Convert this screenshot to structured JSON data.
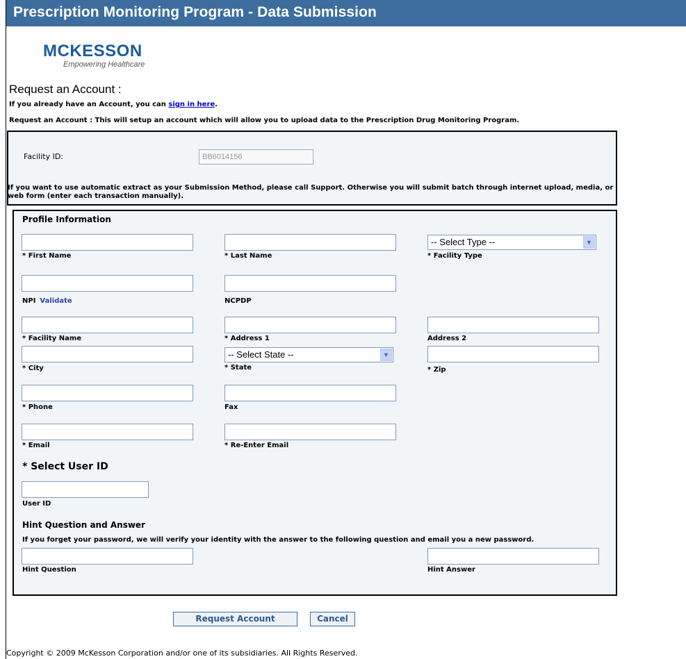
{
  "header": {
    "title": "Prescription Monitoring Program - Data Submission"
  },
  "logo": {
    "brand": "MCKESSON",
    "tagline": "Empowering Healthcare"
  },
  "intro": {
    "heading": "Request an Account :",
    "signin_prefix": "If you already have an Account, you can ",
    "signin_link": "sign in here",
    "signin_suffix": ".",
    "description": "Request an Account : This will setup an account which will allow you to upload data to the Prescription Drug Monitoring Program."
  },
  "facility": {
    "label": "Facility ID:",
    "value": "BB6014156",
    "note": "If you want to use automatic extract as your Submission Method, please call Support. Otherwise you will submit batch through internet upload, media, or web form (enter each transaction manually)."
  },
  "profile": {
    "title": "Profile Information",
    "first_name": "* First Name",
    "last_name": "* Last Name",
    "facility_type": "* Facility Type",
    "facility_type_value": "-- Select Type --",
    "npi": "NPI",
    "validate": "Validate",
    "ncpdp": "NCPDP",
    "facility_name": "* Facility Name",
    "address1": "* Address 1",
    "address2": "Address 2",
    "city": "* City",
    "state": "* State",
    "state_value": "-- Select State --",
    "zip": "* Zip",
    "phone": "* Phone",
    "fax": "Fax",
    "email": "* Email",
    "reemail": "* Re-Enter Email"
  },
  "userid": {
    "title": "* Select User ID",
    "label": "User ID"
  },
  "hint": {
    "title": "Hint Question and Answer",
    "note": "If you forget your password, we will verify your identity with the answer to the following question and email you a new password.",
    "question": "Hint Question",
    "answer": "Hint Answer"
  },
  "buttons": {
    "request": "Request Account",
    "cancel": "Cancel"
  },
  "footer": {
    "copyright": "Copyright © 2009 McKesson Corporation and/or one of its subsidiaries. All Rights Reserved."
  }
}
